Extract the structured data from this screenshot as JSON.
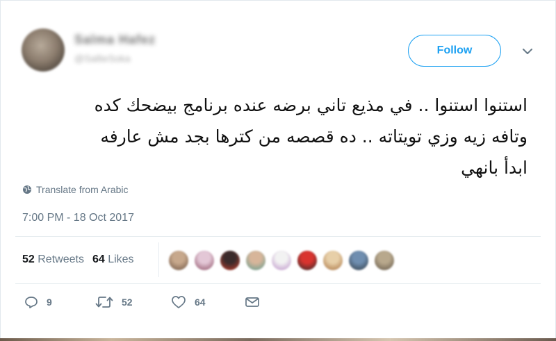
{
  "header": {
    "display_name": "Salma Hafez",
    "handle": "@SallieSoka",
    "follow_label": "Follow"
  },
  "tweet": {
    "lines": [
      "استنوا استنوا .. في مذيع تاني برضه عنده برنامج بيضحك كده",
      "وتافه زيه وزي تويتاته .. ده قصصه من كترها بجد مش عارفه",
      "ابدأ بانهي"
    ],
    "translate_label": "Translate from Arabic",
    "timestamp": "7:00 PM - 18 Oct 2017"
  },
  "stats": {
    "retweets_count": "52",
    "retweets_label": "Retweets",
    "likes_count": "64",
    "likes_label": "Likes"
  },
  "likers": [
    {
      "color_a": "#c7a88c",
      "color_b": "#6b5140"
    },
    {
      "color_a": "#e3c7d6",
      "color_b": "#8a4b61"
    },
    {
      "color_a": "#3b2b2b",
      "color_b": "#c33c2a"
    },
    {
      "color_a": "#d7b59a",
      "color_b": "#5b9c8f"
    },
    {
      "color_a": "#f2f2f2",
      "color_b": "#b98bc6"
    },
    {
      "color_a": "#d9342f",
      "color_b": "#2b2b2b"
    },
    {
      "color_a": "#e7cfa8",
      "color_b": "#a56d3c"
    },
    {
      "color_a": "#6f8eb0",
      "color_b": "#2f3a44"
    },
    {
      "color_a": "#b8a88c",
      "color_b": "#5f5446"
    }
  ],
  "actions": {
    "reply_count": "9",
    "retweet_count": "52",
    "like_count": "64"
  },
  "colors": {
    "accent": "#1da1f2",
    "muted": "#657786"
  }
}
